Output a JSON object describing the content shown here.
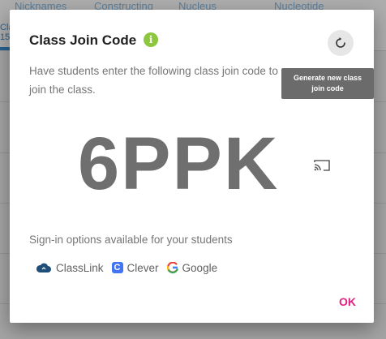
{
  "background": {
    "header_items": [
      "Nicknames",
      "Constructing",
      "Nucleus",
      "Nucleotide"
    ],
    "tab_label": "Cla",
    "tab_count": "15"
  },
  "dialog": {
    "title": "Class Join Code",
    "info_icon_glyph": "i",
    "description": "Have students enter the following class join code to join the class.",
    "refresh_tooltip": "Generate new class join code",
    "join_code": "6PPK",
    "signin_label": "Sign-in options available for your students",
    "providers": [
      {
        "name": "ClassLink",
        "icon": "classlink-icon"
      },
      {
        "name": "Clever",
        "icon": "clever-icon"
      },
      {
        "name": "Google",
        "icon": "google-icon"
      }
    ],
    "clever_glyph": "C",
    "google_glyph": "G",
    "ok_label": "OK"
  },
  "colors": {
    "info_green": "#8dc63f",
    "ok_pink": "#e0217f",
    "clever_blue": "#4274f6",
    "classlink_navy": "#1f4e79"
  }
}
